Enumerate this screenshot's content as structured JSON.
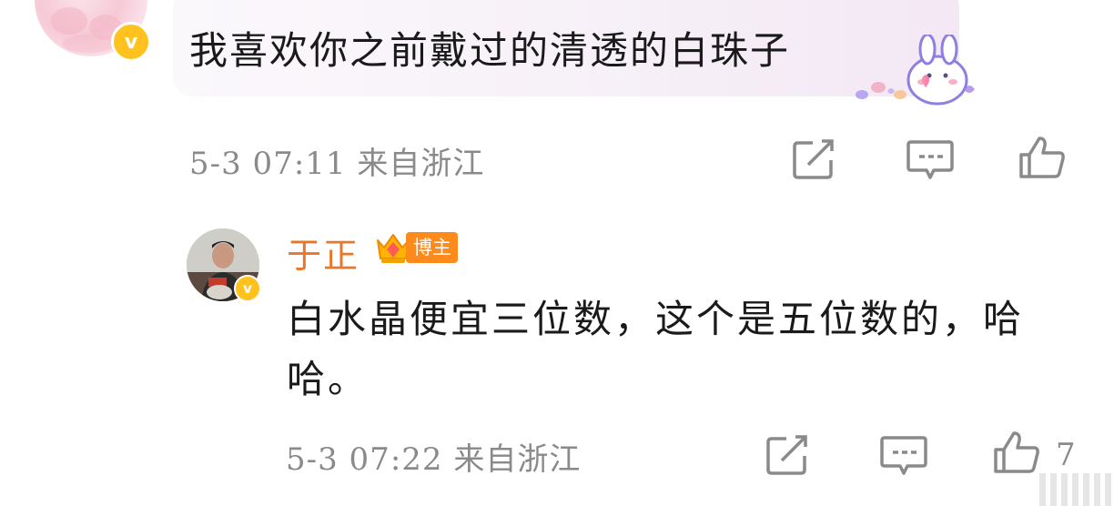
{
  "comment": {
    "text": "我喜欢你之前戴过的清透的白珠子",
    "verified_badge": "v",
    "meta": "5-3 07:11  来自浙江",
    "sticker": "bunny-heart-sticker"
  },
  "reply": {
    "author": "于正",
    "badge_label": "博主",
    "verified_badge": "v",
    "text": "白水晶便宜三位数，这个是五位数的，哈哈。",
    "meta": "5-3 07:22  来自浙江",
    "like_count": "7"
  },
  "colors": {
    "author_orange": "#e8772e",
    "badge_orange": "#ff8a1c",
    "verified_yellow": "#ffc21f",
    "meta_gray": "#8a8a8a",
    "icon_gray": "#8a8a8a"
  },
  "icons": [
    "share-icon",
    "comment-icon",
    "like-icon"
  ]
}
